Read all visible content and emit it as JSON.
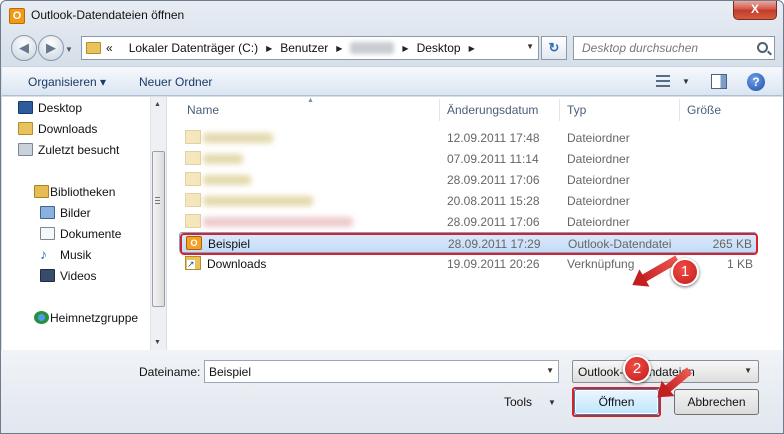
{
  "window": {
    "title": "Outlook-Datendateien öffnen",
    "close_label": "X",
    "app_icon_letter": "O"
  },
  "nav": {
    "crumbs": [
      "Lokaler Datenträger (C:)",
      "Benutzer",
      "Desktop"
    ],
    "crumb_prefix": "«",
    "search_placeholder": "Desktop durchsuchen"
  },
  "toolbar": {
    "organize_label": "Organisieren ▾",
    "new_folder_label": "Neuer Ordner",
    "help_label": "?"
  },
  "sidebar": {
    "favorites": [
      "Desktop",
      "Downloads",
      "Zuletzt besucht"
    ],
    "libraries_label": "Bibliotheken",
    "libraries": [
      "Bilder",
      "Dokumente",
      "Musik",
      "Videos"
    ],
    "homegroup_label": "Heimnetzgruppe"
  },
  "columns": {
    "name": "Name",
    "date": "Änderungsdatum",
    "type": "Typ",
    "size": "Größe"
  },
  "files": [
    {
      "name": "",
      "date": "12.09.2011 17:48",
      "type": "Dateiordner",
      "size": ""
    },
    {
      "name": "",
      "date": "07.09.2011 11:14",
      "type": "Dateiordner",
      "size": ""
    },
    {
      "name": "",
      "date": "28.09.2011 17:06",
      "type": "Dateiordner",
      "size": ""
    },
    {
      "name": "",
      "date": "20.08.2011 15:28",
      "type": "Dateiordner",
      "size": ""
    },
    {
      "name": "",
      "date": "28.09.2011 17:06",
      "type": "Dateiordner",
      "size": ""
    },
    {
      "name": "Beispiel",
      "date": "28.09.2011 17:29",
      "type": "Outlook-Datendatei",
      "size": "265 KB"
    },
    {
      "name": "Downloads",
      "date": "19.09.2011 20:26",
      "type": "Verknüpfung",
      "size": "1 KB"
    }
  ],
  "footer": {
    "filename_label": "Dateiname:",
    "filename_value": "Beispiel",
    "filetype_value": "Outlook-Datendateien",
    "tools_label": "Tools",
    "open_label": "Öffnen",
    "cancel_label": "Abbrechen"
  },
  "callouts": [
    "1",
    "2"
  ],
  "colors": {
    "highlight": "#d7212b",
    "selection": "#c4dcf8",
    "accent": "#1a3a6b"
  }
}
